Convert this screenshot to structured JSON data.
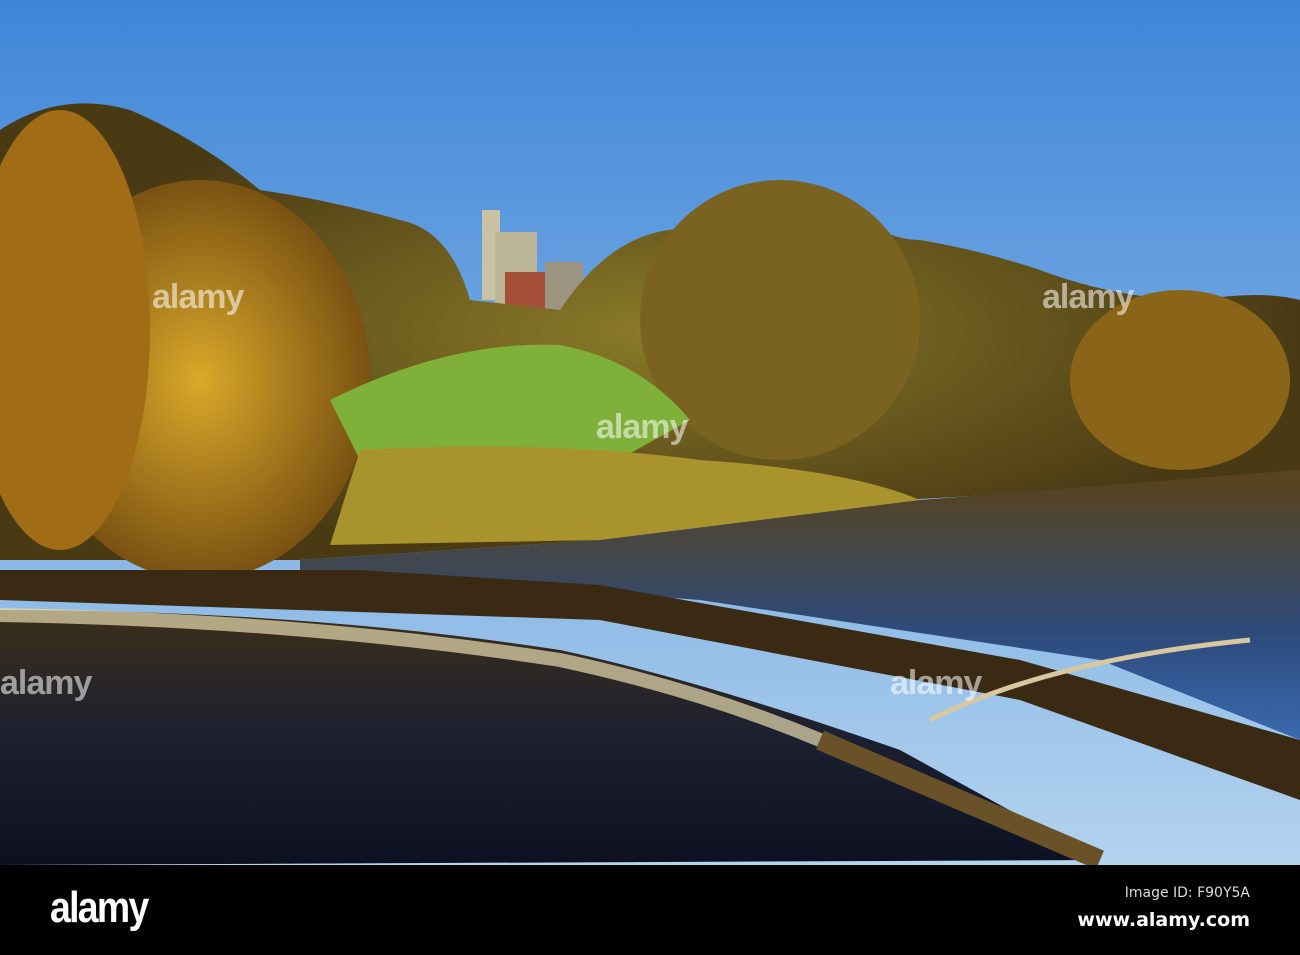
{
  "photo": {
    "subject": "River weir with autumn trees and castle on hill",
    "colors": {
      "sky_top": "#4a8fdc",
      "sky_bottom": "#a7cdec",
      "foliage": "#c08a18",
      "grass": "#7fb03a",
      "water": "#1a1d2a"
    }
  },
  "watermark": {
    "text": "alamy"
  },
  "footer": {
    "logo": "alamy",
    "image_id": "Image ID: F90Y5A",
    "url": "www.alamy.com"
  }
}
